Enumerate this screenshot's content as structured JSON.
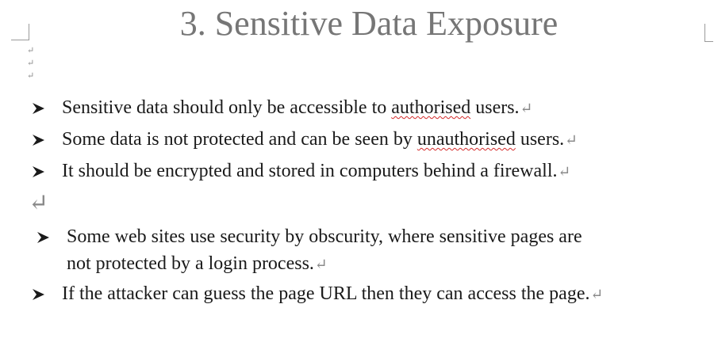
{
  "title": "3. Sensitive Data Exposure",
  "return_mark": "↵",
  "bullets": [
    {
      "segments": [
        {
          "text": "Sensitive data should only be accessible to ",
          "spell_error": false
        },
        {
          "text": "authorised",
          "spell_error": true
        },
        {
          "text": " users.",
          "spell_error": false
        }
      ]
    },
    {
      "segments": [
        {
          "text": "Some data is not protected and can be seen by ",
          "spell_error": false
        },
        {
          "text": "unauthorised",
          "spell_error": true
        },
        {
          "text": " users.",
          "spell_error": false
        }
      ]
    },
    {
      "segments": [
        {
          "text": "It should be encrypted and stored in computers behind a firewall.",
          "spell_error": false
        }
      ]
    }
  ],
  "bullets_after": [
    {
      "lines": [
        "Some web sites use security by obscurity, where sensitive pages are",
        "not protected by a login process."
      ]
    },
    {
      "lines": [
        "If the attacker can guess the page URL then they can access the page."
      ]
    }
  ]
}
